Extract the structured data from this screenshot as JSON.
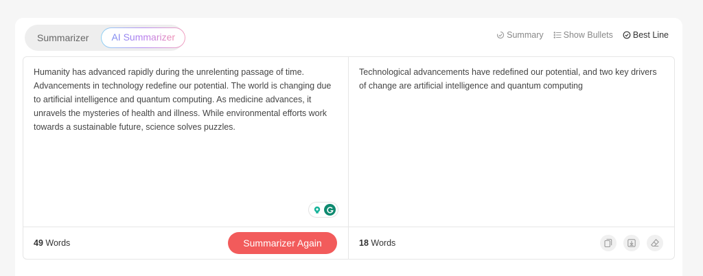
{
  "modes": [
    {
      "label": "Summarizer",
      "active": false
    },
    {
      "label": "AI Summarizer",
      "active": true
    }
  ],
  "view_options": [
    {
      "label": "Summary",
      "icon": "summary-icon",
      "active": false
    },
    {
      "label": "Show Bullets",
      "icon": "bullets-icon",
      "active": false
    },
    {
      "label": "Best Line",
      "icon": "check-circle-icon",
      "active": true
    }
  ],
  "input": {
    "text": "Humanity has advanced rapidly during the unrelenting passage of time. Advancements in technology redefine our potential. The world is changing due to artificial intelligence and quantum computing. As medicine advances, it unravels the mysteries of health and illness. While environmental efforts work towards a sustainable future, science solves puzzles.",
    "word_count": "49",
    "word_label": "Words",
    "button_label": "Summarizer Again"
  },
  "output": {
    "text": "Technological advancements have redefined our potential, and two key drivers of change are artificial intelligence and quantum computing",
    "word_count": "18",
    "word_label": "Words"
  },
  "extension_icons": [
    "lightbulb-icon",
    "grammarly-icon"
  ],
  "tool_icons": [
    "copy-icon",
    "download-icon",
    "eraser-icon"
  ],
  "colors": {
    "accent_button": "#f25b5b",
    "grammarly_green": "#0f8a70"
  }
}
